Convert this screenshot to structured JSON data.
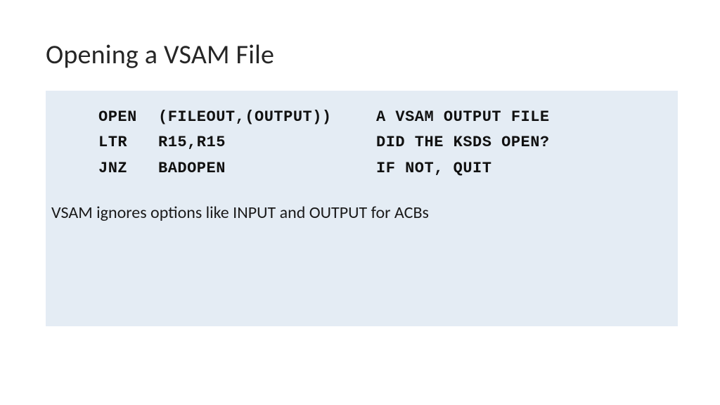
{
  "title": "Opening a VSAM File",
  "code": {
    "rows": [
      {
        "op": "OPEN",
        "args": "(FILEOUT,(OUTPUT))",
        "comment": "A VSAM OUTPUT FILE"
      },
      {
        "op": "LTR",
        "args": "R15,R15",
        "comment": "DID THE KSDS OPEN?"
      },
      {
        "op": "JNZ",
        "args": "BADOPEN",
        "comment": "IF NOT, QUIT"
      }
    ]
  },
  "note": "VSAM ignores options like INPUT and OUTPUT for ACBs"
}
